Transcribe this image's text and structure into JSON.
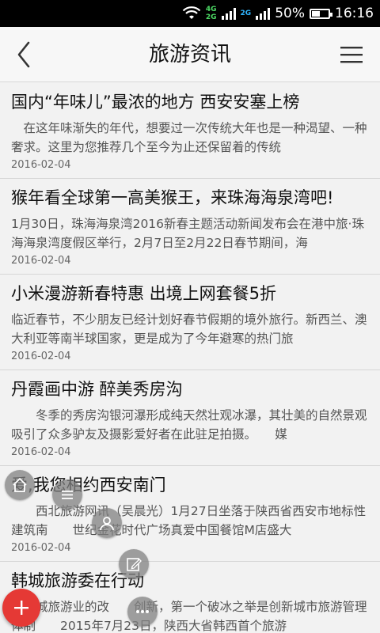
{
  "status_bar": {
    "network_top": "4G",
    "network_bottom": "2G",
    "network2": "2G",
    "battery": "50%",
    "battery_level": 0.5,
    "time": "16:16"
  },
  "header": {
    "title": "旅游资讯",
    "back_icon": "chevron-left-icon",
    "menu_icon": "hamburger-icon"
  },
  "articles": [
    {
      "title": "国内“年味儿”最浓的地方 西安安塞上榜",
      "summary": "　在这年味渐失的年代，想要过一次传统大年也是一种渴望、一种奢求。这里为您推荐几个至今为止还保留着的传统",
      "date": "2016-02-04"
    },
    {
      "title": "猴年看全球第一高美猴王，来珠海海泉湾吧!",
      "summary": "1月30日，珠海海泉湾2016新春主题活动新闻发布会在港中旅·珠海海泉湾度假区举行，2月7日至2月22日春节期间，海",
      "date": "2016-02-04"
    },
    {
      "title": "小米漫游新春特惠 出境上网套餐5折",
      "summary": "临近春节，不少朋友已经计划好春节假期的境外旅行。新西兰、澳大利亚等南半球国家，更是成为了今年避寒的热门旅",
      "date": "2016-02-04"
    },
    {
      "title": "丹霞画中游 醉美秀房沟",
      "summary": "　　冬季的秀房沟银河瀑形成纯天然壮观冰瀑，其壮美的自然景观吸引了众多驴友及摄影爱好者在此驻足拍摄。　　媒",
      "date": "2016-02-04"
    },
    {
      "title": "爱,我您相约西安南门",
      "summary": "　　西北旅游网讯（吴晨光）1月27日坐落于陕西省西安市地标性建筑南　　世纪金花时代广场真爱中国餐馆M店盛大",
      "date": "2016-02-04"
    },
    {
      "title": "韩城旅游委在行动",
      "summary": "　韩城旅游业的改　　创新，第一个破冰之举是创新城市旅游管理体制　　2015年7月23日，陕西大省韩西首个旅游",
      "date": ""
    }
  ],
  "fab_menu": {
    "items": [
      "home-icon",
      "list-icon",
      "user-icon",
      "edit-icon",
      "more-icon"
    ],
    "main": "plus-icon",
    "accent": "#e53935"
  }
}
